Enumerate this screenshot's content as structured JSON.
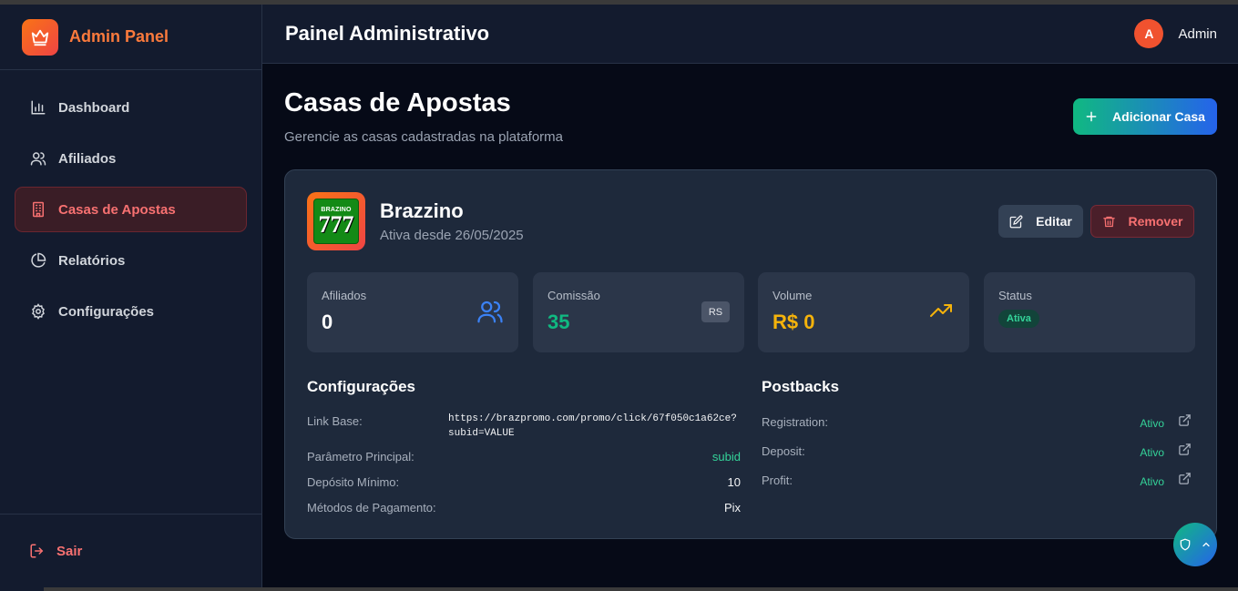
{
  "sidebar": {
    "brand_title": "Admin Panel",
    "items": [
      {
        "label": "Dashboard",
        "icon": "bar-chart-icon",
        "active": false
      },
      {
        "label": "Afiliados",
        "icon": "users-icon",
        "active": false
      },
      {
        "label": "Casas de Apostas",
        "icon": "building-icon",
        "active": true
      },
      {
        "label": "Relatórios",
        "icon": "pie-chart-icon",
        "active": false
      },
      {
        "label": "Configurações",
        "icon": "gear-icon",
        "active": false
      }
    ],
    "logout_label": "Sair"
  },
  "header": {
    "title": "Painel Administrativo",
    "avatar_initial": "A",
    "user_name": "Admin"
  },
  "page": {
    "title": "Casas de Apostas",
    "subtitle": "Gerencie as casas cadastradas na plataforma",
    "add_button": "Adicionar Casa"
  },
  "house": {
    "logo_text_top": "BRAZINO",
    "logo_text_main": "777",
    "name": "Brazzino",
    "since": "Ativa desde 26/05/2025",
    "edit_label": "Editar",
    "remove_label": "Remover",
    "stats": {
      "affiliates": {
        "label": "Afiliados",
        "value": "0"
      },
      "commission": {
        "label": "Comissão",
        "value": "35",
        "badge": "RS"
      },
      "volume": {
        "label": "Volume",
        "value": "R$ 0"
      },
      "status": {
        "label": "Status",
        "value": "Ativa"
      }
    },
    "config": {
      "title": "Configurações",
      "link_base_label": "Link Base:",
      "link_base_value_line1": "https://brazpromo.com/promo/click/67f050c1a62ce?",
      "link_base_value_line2": "subid=VALUE",
      "param_label": "Parâmetro Principal:",
      "param_value": "subid",
      "min_deposit_label": "Depósito Mínimo:",
      "min_deposit_value": "10",
      "payment_label": "Métodos de Pagamento:",
      "payment_value": "Pix"
    },
    "postbacks": {
      "title": "Postbacks",
      "items": [
        {
          "label": "Registration:",
          "status": "Ativo"
        },
        {
          "label": "Deposit:",
          "status": "Ativo"
        },
        {
          "label": "Profit:",
          "status": "Ativo"
        }
      ]
    }
  },
  "colors": {
    "accent_orange": "#f97316",
    "accent_red": "#f87171",
    "accent_green": "#34d399",
    "accent_blue": "#2563eb",
    "volume_yellow": "#f5b30b"
  }
}
